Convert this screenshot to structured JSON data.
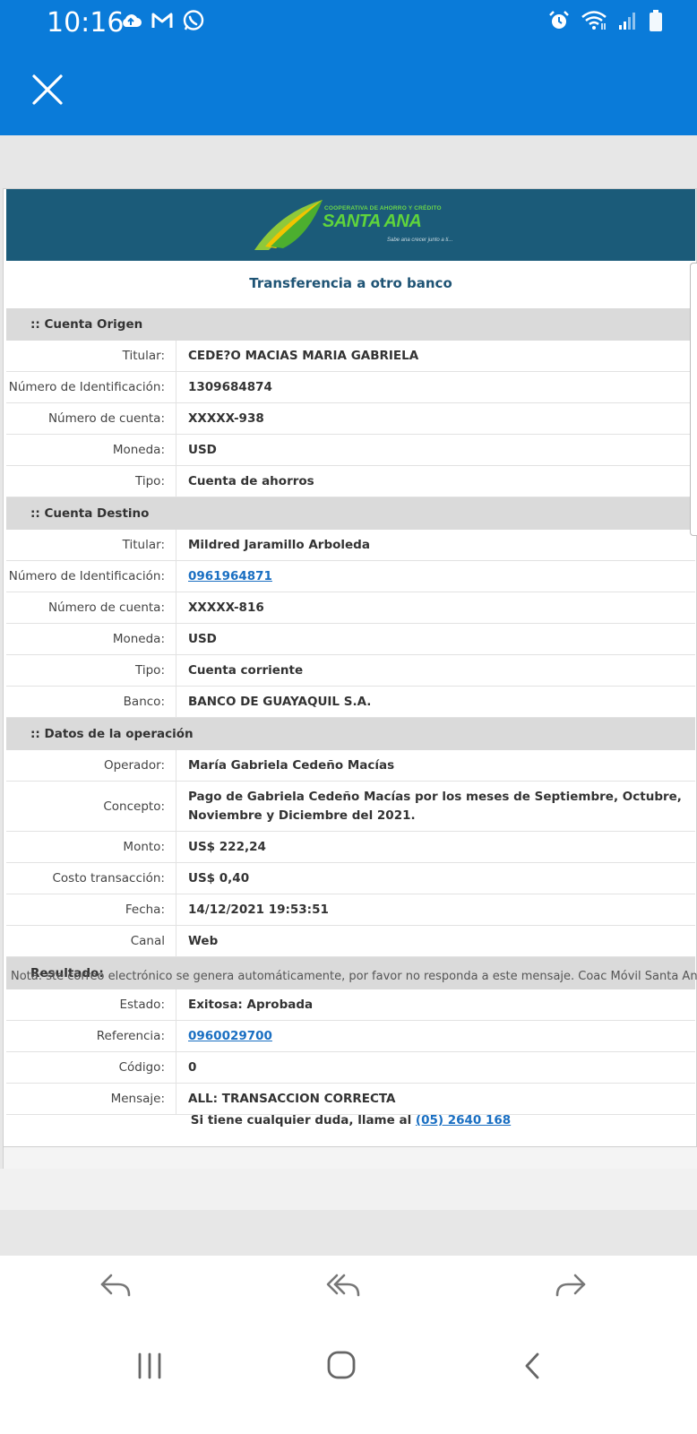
{
  "status_bar": {
    "time": "10:16",
    "left_icons": [
      "cloud-upload-icon",
      "gmail-icon",
      "whatsapp-icon"
    ],
    "right_icons": [
      "alarm-icon",
      "wifi-icon",
      "signal-icon",
      "battery-icon"
    ]
  },
  "app_bar": {
    "close_icon": "close-icon"
  },
  "email": {
    "logo": {
      "line1": "COOPERATIVA DE AHORRO Y CRÉDITO",
      "line2": "SANTA ANA",
      "slogan": "Sabe ana crecer junto a ti..."
    },
    "title": "Transferencia a otro banco",
    "sections": {
      "origen": {
        "header": ":: Cuenta Origen",
        "rows": [
          {
            "label": "Titular:",
            "value": "CEDE?O MACIAS MARIA GABRIELA"
          },
          {
            "label": "Número de Identificación:",
            "value": "1309684874"
          },
          {
            "label": "Número de cuenta:",
            "value": "XXXXX-938"
          },
          {
            "label": "Moneda:",
            "value": "USD"
          },
          {
            "label": "Tipo:",
            "value": "Cuenta de ahorros"
          }
        ]
      },
      "destino": {
        "header": ":: Cuenta Destino",
        "rows": [
          {
            "label": "Titular:",
            "value": "Mildred Jaramillo Arboleda"
          },
          {
            "label": "Número de Identificación:",
            "value": "0961964871"
          },
          {
            "label": "Número de cuenta:",
            "value": "XXXXX-816"
          },
          {
            "label": "Moneda:",
            "value": "USD"
          },
          {
            "label": "Tipo:",
            "value": "Cuenta corriente"
          },
          {
            "label": "Banco:",
            "value": "BANCO DE GUAYAQUIL S.A."
          }
        ]
      },
      "operacion": {
        "header": ":: Datos de la operación",
        "rows": [
          {
            "label": "Operador:",
            "value": "María Gabriela Cedeño Macías"
          },
          {
            "label": "Concepto:",
            "value": "Pago de Gabriela Cedeño Macías por los meses de Septiembre, Octubre, Noviembre y Diciembre del 2021."
          },
          {
            "label": "Monto:",
            "value": "US$ 222,24"
          },
          {
            "label": "Costo transacción:",
            "value": "US$ 0,40"
          },
          {
            "label": "Fecha:",
            "value": "14/12/2021 19:53:51"
          },
          {
            "label": "Canal",
            "value": "Web"
          }
        ]
      },
      "resultado": {
        "header": "Resultado:",
        "rows": [
          {
            "label": "Estado:",
            "value": "Exitosa: Aprobada"
          },
          {
            "label": "Referencia:",
            "value": "0960029700"
          },
          {
            "label": "Código:",
            "value": "0"
          },
          {
            "label": "Mensaje:",
            "value": "ALL: TRANSACCION CORRECTA"
          }
        ]
      }
    },
    "call_us": {
      "text": "Si tiene cualquier duda, llame al",
      "phone": "(05) 2640 168"
    },
    "note": "Nota: ste correo electrónico se genera automáticamente, por favor no responda a este mensaje. Coac Móvil Santa Ana."
  },
  "actions": {
    "reply_icon": "reply-icon",
    "reply_all_icon": "reply-all-icon",
    "forward_icon": "forward-icon"
  },
  "nav_bar": {
    "recents_icon": "recents-icon",
    "home_icon": "home-icon",
    "back_icon": "back-icon"
  },
  "colors": {
    "app_bar": "#0a7bd9",
    "banner": "#1b5b79",
    "link": "#1a6fc2",
    "section_bg": "#dadada"
  }
}
